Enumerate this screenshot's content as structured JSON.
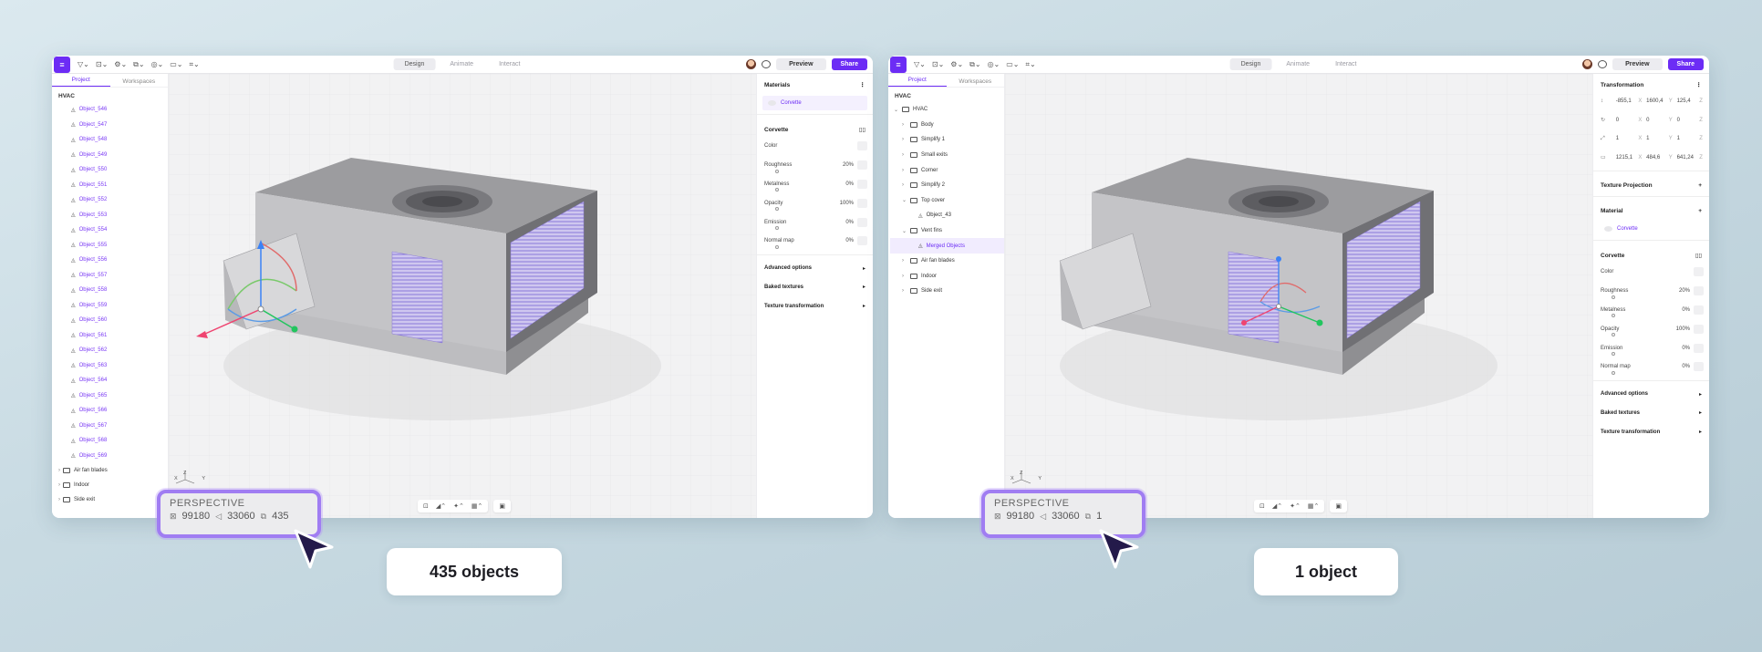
{
  "topbar": {
    "tools": [
      "▽⌄",
      "⊡⌄",
      "⚙⌄",
      "⧉⌄",
      "◎⌄",
      "▭⌄",
      "⌗⌄"
    ],
    "modes": [
      "Design",
      "Animate",
      "Interact"
    ],
    "preview": "Preview",
    "share": "Share"
  },
  "panel_tabs": {
    "project": "Project",
    "workspaces": "Workspaces"
  },
  "left_window": {
    "scene_title": "HVAC",
    "objects": [
      "Object_546",
      "Object_547",
      "Object_548",
      "Object_549",
      "Object_550",
      "Object_551",
      "Object_552",
      "Object_553",
      "Object_554",
      "Object_555",
      "Object_556",
      "Object_557",
      "Object_558",
      "Object_559",
      "Object_560",
      "Object_561",
      "Object_562",
      "Object_563",
      "Object_564",
      "Object_565",
      "Object_566",
      "Object_567",
      "Object_568",
      "Object_569"
    ],
    "groups": [
      "Air fan blades",
      "Indoor",
      "Side exit"
    ],
    "materials_title": "Materials",
    "material_name": "Corvette",
    "material_section": "Corvette",
    "props": [
      {
        "label": "Color",
        "value": ""
      },
      {
        "label": "Roughness",
        "value": "20%"
      },
      {
        "label": "Metalness",
        "value": "0%"
      },
      {
        "label": "Opacity",
        "value": "100%"
      },
      {
        "label": "Emission",
        "value": "0%"
      },
      {
        "label": "Normal map",
        "value": "0%"
      }
    ],
    "expanders": [
      "Advanced options",
      "Baked textures",
      "Texture transformation"
    ],
    "stats": {
      "mode": "PERSPECTIVE",
      "vertices": "99180",
      "triangles": "33060",
      "objects": "435"
    },
    "caption": "435 objects"
  },
  "right_window": {
    "scene_title": "HVAC",
    "tree": [
      {
        "label": "HVAC",
        "indent": 0,
        "chev": "⌄"
      },
      {
        "label": "Body",
        "indent": 1,
        "chev": "›"
      },
      {
        "label": "Simplify 1",
        "indent": 1,
        "chev": "›"
      },
      {
        "label": "Small exits",
        "indent": 1,
        "chev": "›"
      },
      {
        "label": "Corner",
        "indent": 1,
        "chev": "›"
      },
      {
        "label": "Simplify 2",
        "indent": 1,
        "chev": "›"
      },
      {
        "label": "Top cover",
        "indent": 1,
        "chev": "⌄"
      },
      {
        "label": "Object_43",
        "indent": 2,
        "chev": ""
      },
      {
        "label": "Vent fins",
        "indent": 1,
        "chev": "⌄"
      },
      {
        "label": "Merged Objects",
        "indent": 2,
        "chev": "",
        "selected": true
      },
      {
        "label": "Air fan blades",
        "indent": 1,
        "chev": "›"
      },
      {
        "label": "Indoor",
        "indent": 1,
        "chev": "›"
      },
      {
        "label": "Side exit",
        "indent": 1,
        "chev": "›"
      }
    ],
    "transform_title": "Transformation",
    "transform_rows": [
      {
        "icon": "↕",
        "x": "-855,1",
        "y": "1600,4",
        "z": "125,4"
      },
      {
        "icon": "↻",
        "x": "0",
        "y": "0",
        "z": "0"
      },
      {
        "icon": "⤢",
        "x": "1",
        "y": "1",
        "z": "1"
      },
      {
        "icon": "▭",
        "x": "1215,1",
        "y": "484,6",
        "z": "641,24"
      }
    ],
    "texture_projection": "Texture Projection",
    "material_title": "Material",
    "material_name": "Corvette",
    "material_section": "Corvette",
    "props": [
      {
        "label": "Color",
        "value": ""
      },
      {
        "label": "Roughness",
        "value": "20%"
      },
      {
        "label": "Metalness",
        "value": "0%"
      },
      {
        "label": "Opacity",
        "value": "100%"
      },
      {
        "label": "Emission",
        "value": "0%"
      },
      {
        "label": "Normal map",
        "value": "0%"
      }
    ],
    "expanders": [
      "Advanced options",
      "Baked textures",
      "Texture transformation"
    ],
    "stats": {
      "mode": "PERSPECTIVE",
      "vertices": "99180",
      "triangles": "33060",
      "objects": "1"
    },
    "caption": "1 object"
  },
  "axis": {
    "z": "Z",
    "x": "X",
    "y": "Y"
  },
  "colors": {
    "accent": "#6c2cf5",
    "highlight": "#a07df2"
  }
}
